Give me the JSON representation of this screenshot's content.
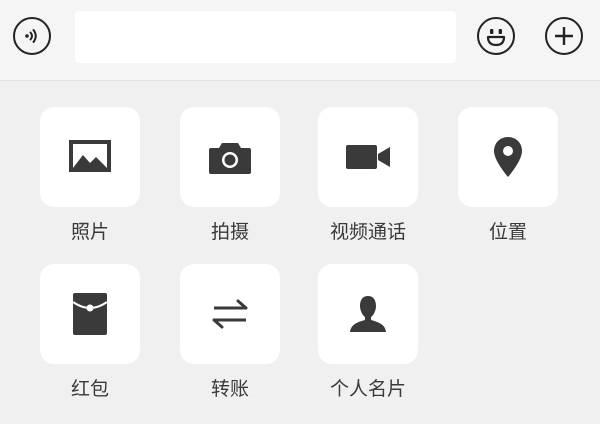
{
  "input_bar": {
    "voice_icon": "voice-icon",
    "emoji_icon": "emoji-icon",
    "plus_icon": "plus-icon",
    "message_value": ""
  },
  "panel": {
    "items": [
      {
        "label": "照片",
        "icon": "image-icon"
      },
      {
        "label": "拍摄",
        "icon": "camera-icon"
      },
      {
        "label": "视频通话",
        "icon": "video-camera-icon"
      },
      {
        "label": "位置",
        "icon": "location-pin-icon"
      },
      {
        "label": "红包",
        "icon": "red-envelope-icon"
      },
      {
        "label": "转账",
        "icon": "transfer-icon"
      },
      {
        "label": "个人名片",
        "icon": "contact-card-icon"
      }
    ]
  },
  "colors": {
    "icon": "#3a3a3a",
    "tile_background": "#ffffff",
    "panel_background": "#f0f0f0"
  }
}
